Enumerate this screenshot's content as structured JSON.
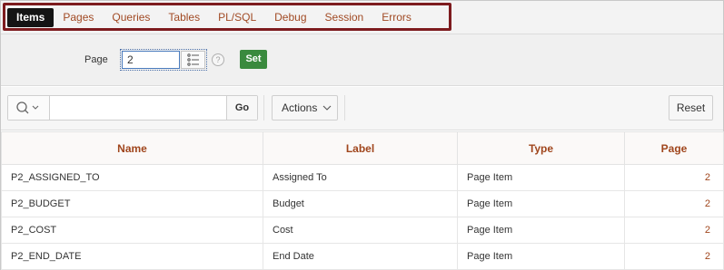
{
  "tabs": [
    {
      "label": "Items",
      "active": true
    },
    {
      "label": "Pages"
    },
    {
      "label": "Queries"
    },
    {
      "label": "Tables"
    },
    {
      "label": "PL/SQL"
    },
    {
      "label": "Debug"
    },
    {
      "label": "Session"
    },
    {
      "label": "Errors"
    }
  ],
  "page_selector": {
    "label": "Page",
    "value": "2",
    "help": "?",
    "set_label": "Set"
  },
  "toolbar": {
    "search_value": "",
    "go_label": "Go",
    "actions_label": "Actions",
    "reset_label": "Reset"
  },
  "grid": {
    "columns": [
      "Name",
      "Label",
      "Type",
      "Page"
    ],
    "rows": [
      [
        "P2_ASSIGNED_TO",
        "Assigned To",
        "Page Item",
        "2"
      ],
      [
        "P2_BUDGET",
        "Budget",
        "Page Item",
        "2"
      ],
      [
        "P2_COST",
        "Cost",
        "Page Item",
        "2"
      ],
      [
        "P2_END_DATE",
        "End Date",
        "Page Item",
        "2"
      ]
    ]
  },
  "colors": {
    "tab_text": "#a14a24",
    "highlight_border": "#7d1b1e",
    "set_button": "#3a8a3e",
    "header_text": "#a0461d"
  }
}
